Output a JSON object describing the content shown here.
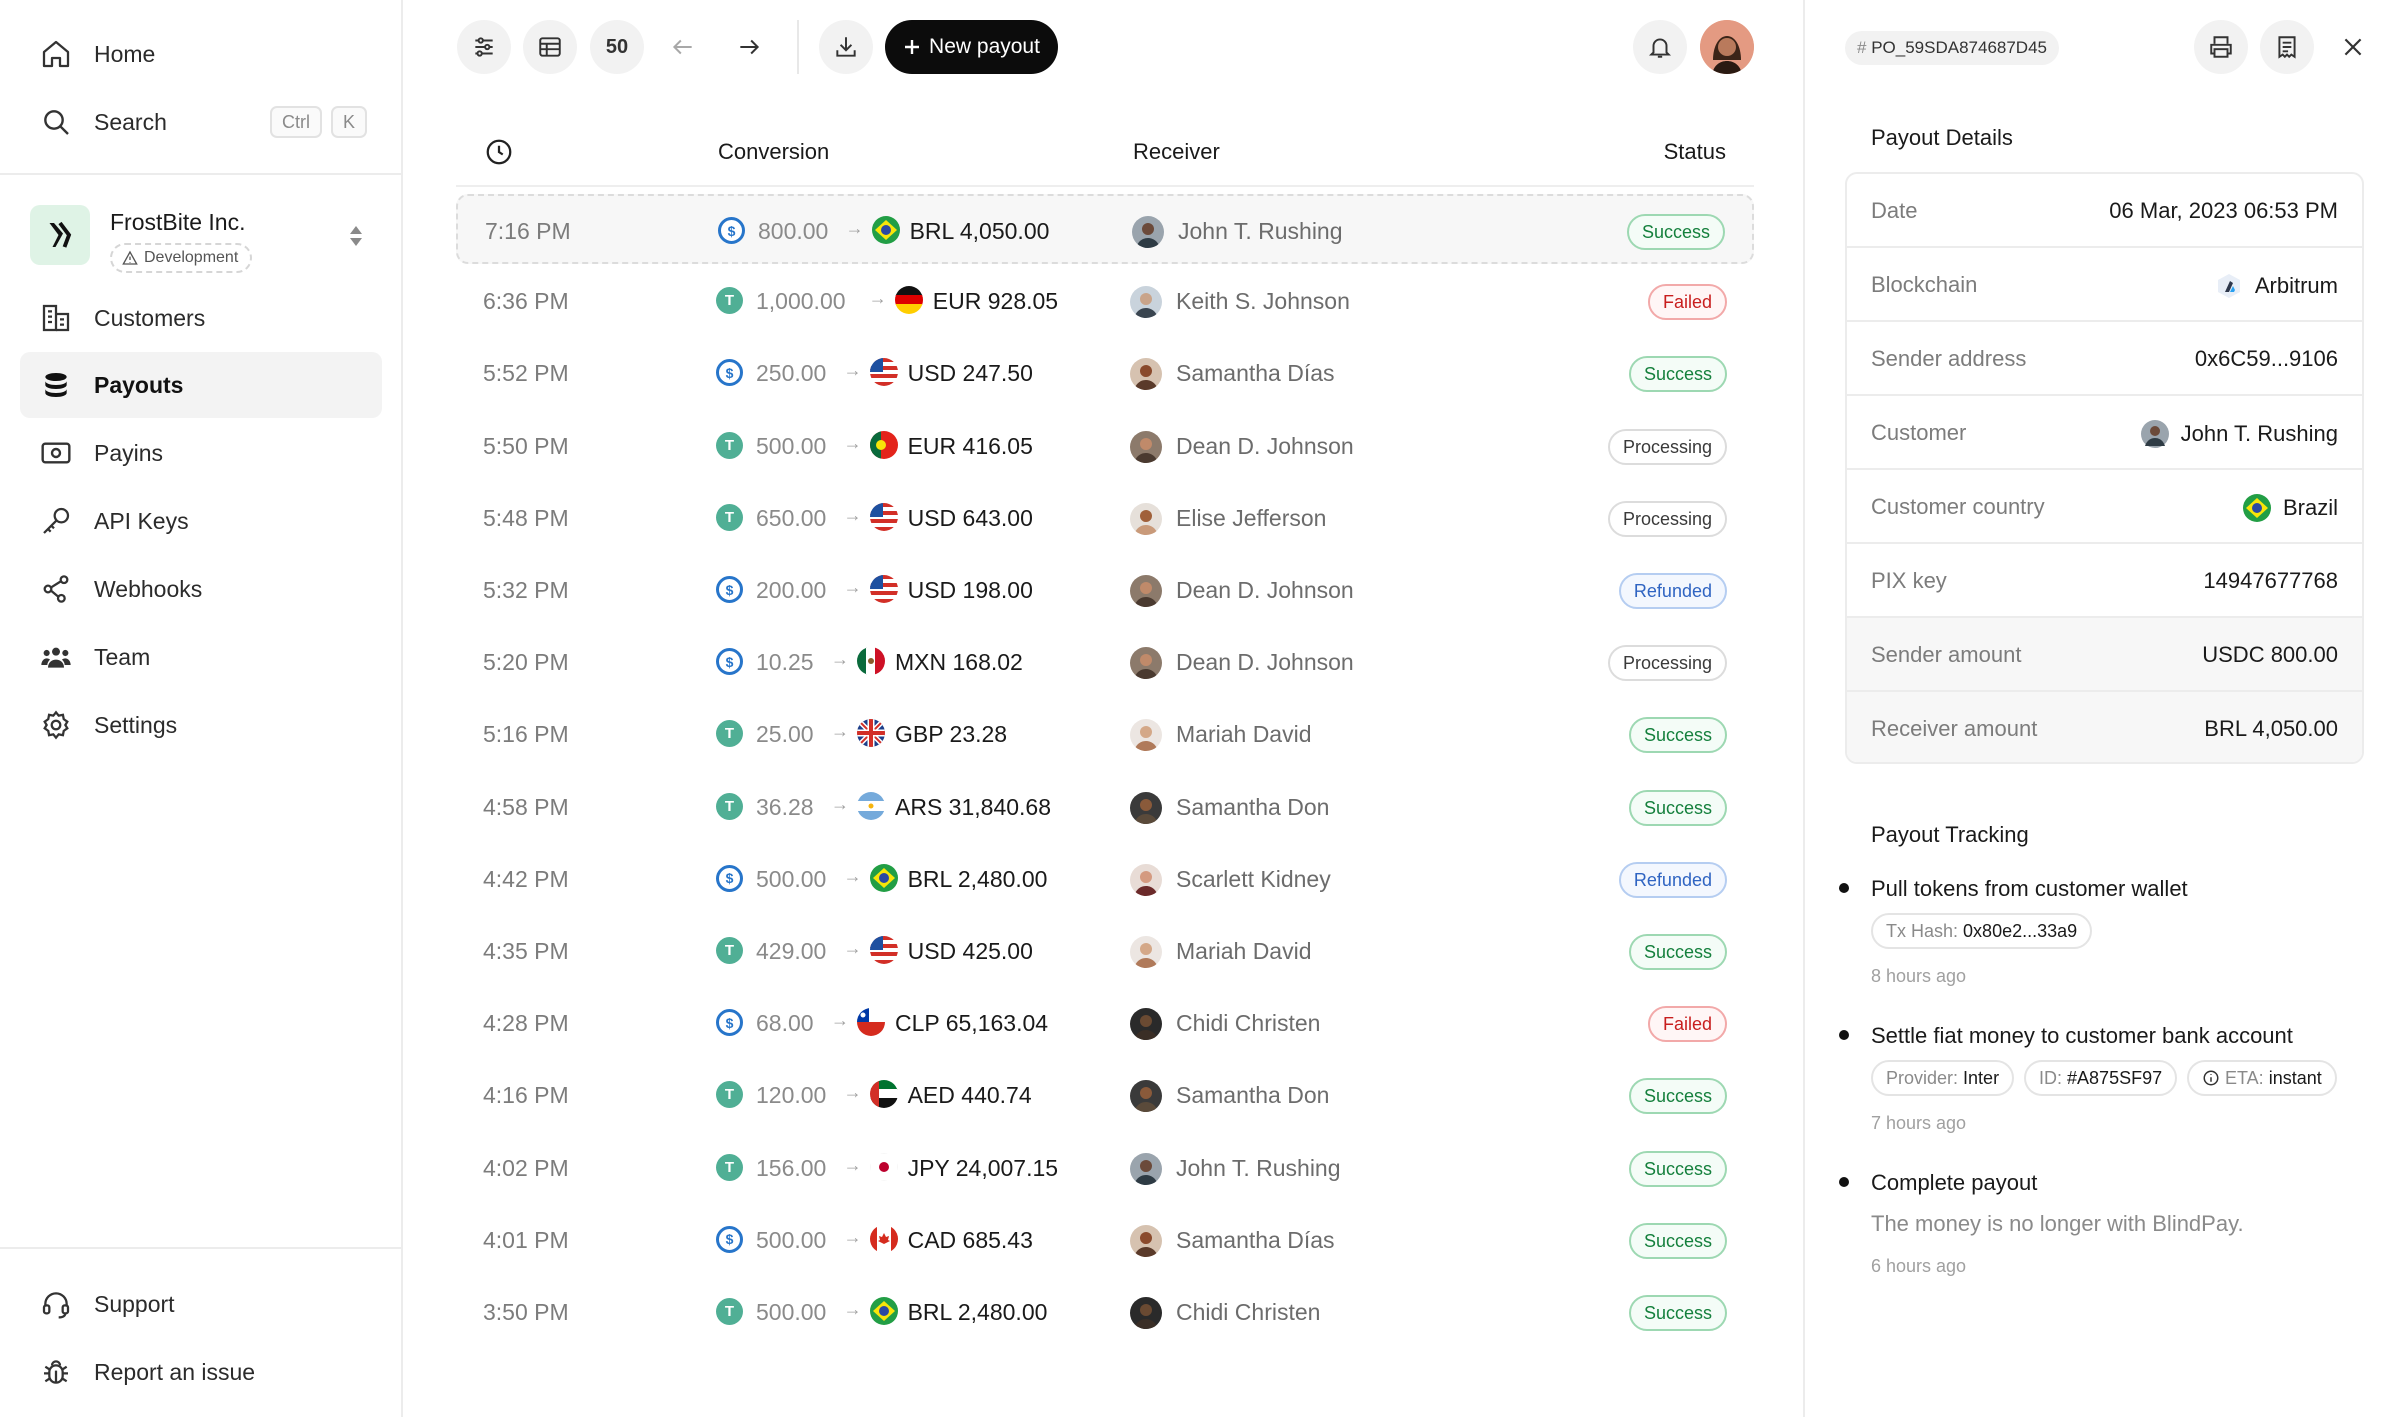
{
  "sidebar": {
    "home": "Home",
    "search": "Search",
    "search_kbd_ctrl": "Ctrl",
    "search_kbd_k": "K",
    "org_name": "FrostBite Inc.",
    "org_env": "Development",
    "items": {
      "customers": "Customers",
      "payouts": "Payouts",
      "payins": "Payins",
      "api_keys": "API Keys",
      "webhooks": "Webhooks",
      "team": "Team",
      "settings": "Settings"
    },
    "support": "Support",
    "report": "Report an issue"
  },
  "toolbar": {
    "page_size": "50",
    "new_payout": "New payout"
  },
  "table": {
    "headers": {
      "conversion": "Conversion",
      "receiver": "Receiver",
      "status": "Status"
    },
    "rows": [
      {
        "time": "7:16 PM",
        "token": "USDC",
        "amount": "800.00",
        "flag": "BR",
        "fiat": "BRL 4,050.00",
        "receiver": "John T. Rushing",
        "status": "Success"
      },
      {
        "time": "6:36 PM",
        "token": "USDT",
        "amount": "1,000.00",
        "flag": "DE",
        "fiat": "EUR 928.05",
        "receiver": "Keith S. Johnson",
        "status": "Failed"
      },
      {
        "time": "5:52 PM",
        "token": "USDC",
        "amount": "250.00",
        "flag": "US",
        "fiat": "USD 247.50",
        "receiver": "Samantha Días",
        "status": "Success"
      },
      {
        "time": "5:50 PM",
        "token": "USDT",
        "amount": "500.00",
        "flag": "PT",
        "fiat": "EUR 416.05",
        "receiver": "Dean D. Johnson",
        "status": "Processing"
      },
      {
        "time": "5:48 PM",
        "token": "USDT",
        "amount": "650.00",
        "flag": "US",
        "fiat": "USD 643.00",
        "receiver": "Elise Jefferson",
        "status": "Processing"
      },
      {
        "time": "5:32 PM",
        "token": "USDC",
        "amount": "200.00",
        "flag": "US",
        "fiat": "USD 198.00",
        "receiver": "Dean D. Johnson",
        "status": "Refunded"
      },
      {
        "time": "5:20 PM",
        "token": "USDC",
        "amount": "10.25",
        "flag": "MX",
        "fiat": "MXN 168.02",
        "receiver": "Dean D. Johnson",
        "status": "Processing"
      },
      {
        "time": "5:16 PM",
        "token": "USDT",
        "amount": "25.00",
        "flag": "GB",
        "fiat": "GBP 23.28",
        "receiver": "Mariah David",
        "status": "Success"
      },
      {
        "time": "4:58 PM",
        "token": "USDT",
        "amount": "36.28",
        "flag": "AR",
        "fiat": "ARS 31,840.68",
        "receiver": "Samantha Don",
        "status": "Success"
      },
      {
        "time": "4:42 PM",
        "token": "USDC",
        "amount": "500.00",
        "flag": "BR",
        "fiat": "BRL 2,480.00",
        "receiver": "Scarlett Kidney",
        "status": "Refunded"
      },
      {
        "time": "4:35 PM",
        "token": "USDT",
        "amount": "429.00",
        "flag": "US",
        "fiat": "USD 425.00",
        "receiver": "Mariah David",
        "status": "Success"
      },
      {
        "time": "4:28 PM",
        "token": "USDC",
        "amount": "68.00",
        "flag": "CL",
        "fiat": "CLP 65,163.04",
        "receiver": "Chidi Christen",
        "status": "Failed"
      },
      {
        "time": "4:16 PM",
        "token": "USDT",
        "amount": "120.00",
        "flag": "AE",
        "fiat": "AED 440.74",
        "receiver": "Samantha Don",
        "status": "Success"
      },
      {
        "time": "4:02 PM",
        "token": "USDT",
        "amount": "156.00",
        "flag": "JP",
        "fiat": "JPY 24,007.15",
        "receiver": "John T. Rushing",
        "status": "Success"
      },
      {
        "time": "4:01 PM",
        "token": "USDC",
        "amount": "500.00",
        "flag": "CA",
        "fiat": "CAD 685.43",
        "receiver": "Samantha Días",
        "status": "Success"
      },
      {
        "time": "3:50 PM",
        "token": "USDT",
        "amount": "500.00",
        "flag": "BR",
        "fiat": "BRL 2,480.00",
        "receiver": "Chidi Christen",
        "status": "Success"
      }
    ]
  },
  "panel": {
    "payout_id": "PO_59SDA874687D45",
    "details_title": "Payout Details",
    "details": {
      "date_k": "Date",
      "date_v": "06 Mar, 2023 06:53 PM",
      "chain_k": "Blockchain",
      "chain_v": "Arbitrum",
      "sender_k": "Sender address",
      "sender_v": "0x6C59...9106",
      "customer_k": "Customer",
      "customer_v": "John T. Rushing",
      "country_k": "Customer country",
      "country_v": "Brazil",
      "pix_k": "PIX key",
      "pix_v": "14947677768",
      "samt_k": "Sender amount",
      "samt_v": "USDC 800.00",
      "ramt_k": "Receiver amount",
      "ramt_v": "BRL 4,050.00"
    },
    "tracking_title": "Payout Tracking",
    "steps": {
      "s1_title": "Pull tokens from customer wallet",
      "s1_hash_label": "Tx Hash:",
      "s1_hash_value": "0x80e2...33a9",
      "s1_ago": "8 hours ago",
      "s2_title": "Settle fiat money to customer bank account",
      "s2_provider_label": "Provider:",
      "s2_provider_value": "Inter",
      "s2_id_label": "ID:",
      "s2_id_value": "#A875SF97",
      "s2_eta_label": "ETA:",
      "s2_eta_value": "instant",
      "s2_ago": "7 hours ago",
      "s3_title": "Complete payout",
      "s3_desc": "The money is no longer with BlindPay.",
      "s3_ago": "6 hours ago"
    }
  },
  "colors": {
    "success": "#15803d",
    "failed": "#c81e1e",
    "refunded": "#2f64c2",
    "usdt": "#50af95",
    "usdc": "#2775ca",
    "primary_button": "#0c0c0c"
  }
}
